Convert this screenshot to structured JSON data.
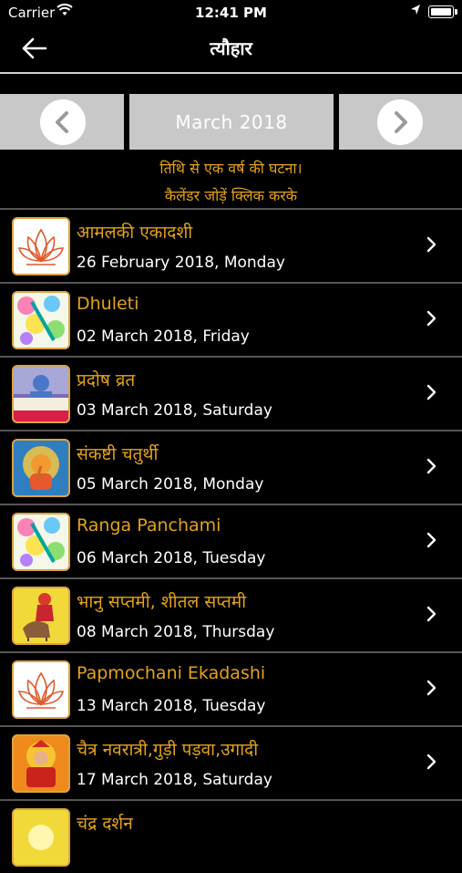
{
  "status_bar": {
    "carrier": "Carrier",
    "time": "12:41 PM"
  },
  "navbar": {
    "title": "त्यौहार",
    "back_icon": "back-arrow-icon"
  },
  "month_selector": {
    "month": "March 2018",
    "prev_icon": "chevron-left-icon",
    "next_icon": "chevron-right-icon"
  },
  "info": {
    "line1": "तिथि से एक वर्ष की घटना।",
    "line2": "कैलेंडर जोड़ें क्लिक करके"
  },
  "festivals": [
    {
      "name": "आमलकी एकादशी",
      "date": "26 February 2018, Monday",
      "icon": "lotus-icon"
    },
    {
      "name": "Dhuleti",
      "date": "02 March 2018, Friday",
      "icon": "holi-colors-icon"
    },
    {
      "name": "प्रदोष व्रत",
      "date": "03 March 2018, Saturday",
      "icon": "shiva-pradosh-icon"
    },
    {
      "name": "संकष्टी चतुर्थी",
      "date": "05 March 2018, Monday",
      "icon": "ganesha-icon"
    },
    {
      "name": "Ranga Panchami",
      "date": "06 March 2018, Tuesday",
      "icon": "holi-colors-icon"
    },
    {
      "name": "भानु सप्तमी, शीतल सप्तमी",
      "date": "08 March 2018, Thursday",
      "icon": "sheetala-mata-icon"
    },
    {
      "name": "Papmochani Ekadashi",
      "date": "13 March 2018, Tuesday",
      "icon": "lotus-icon"
    },
    {
      "name": "चैत्र नवरात्री,गुड़ी पड़वा,उगादी",
      "date": "17 March 2018, Saturday",
      "icon": "durga-icon"
    },
    {
      "name": "चंद्र दर्शन",
      "date": "",
      "icon": "chandra-icon"
    }
  ],
  "colors": {
    "accent": "#e3a21a",
    "background": "#000000",
    "selector_gray": "#c8c8c8"
  }
}
